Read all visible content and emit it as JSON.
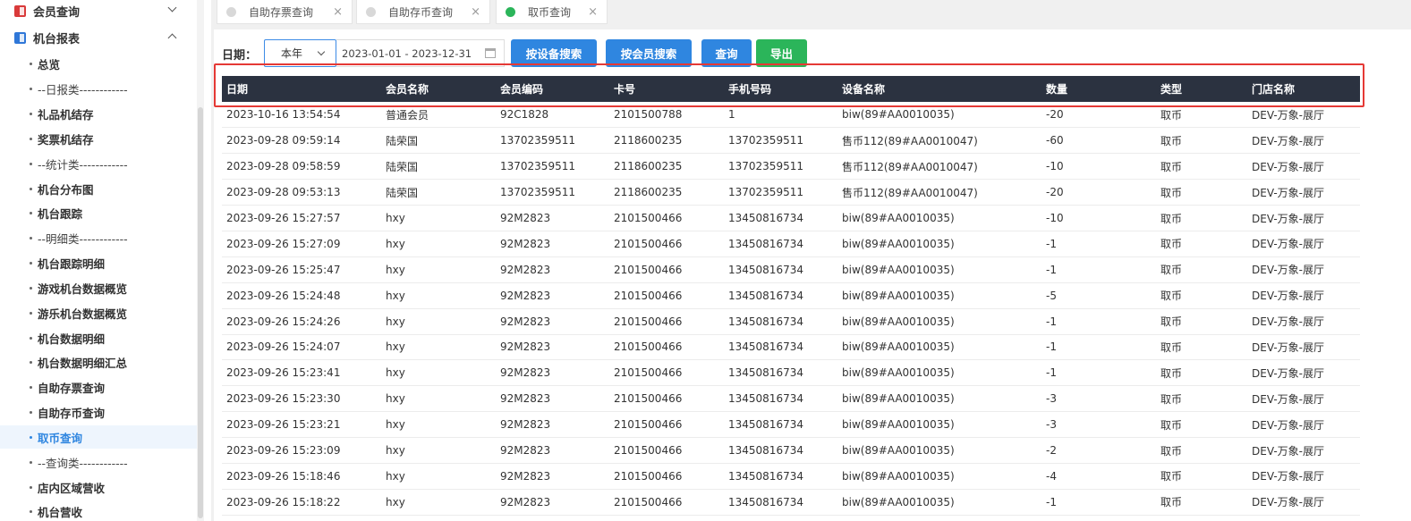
{
  "sidebar": {
    "groups": [
      {
        "label": "会员查询",
        "icon": "member-report-icon",
        "color": "#d93a3a"
      },
      {
        "label": "机台报表",
        "icon": "machine-report-icon",
        "color": "#2f77d8"
      }
    ],
    "items": [
      {
        "label": "总览"
      },
      {
        "label": "--日报类------------"
      },
      {
        "label": "礼品机结存"
      },
      {
        "label": "奖票机结存"
      },
      {
        "label": "--统计类------------"
      },
      {
        "label": "机台分布图"
      },
      {
        "label": "机台跟踪"
      },
      {
        "label": "--明细类------------"
      },
      {
        "label": "机台跟踪明细"
      },
      {
        "label": "游戏机台数据概览"
      },
      {
        "label": "游乐机台数据概览"
      },
      {
        "label": "机台数据明细"
      },
      {
        "label": "机台数据明细汇总"
      },
      {
        "label": "自助存票查询"
      },
      {
        "label": "自助存币查询"
      },
      {
        "label": "取币查询"
      },
      {
        "label": "--查询类------------"
      },
      {
        "label": "店内区域营收"
      },
      {
        "label": "机台营收"
      }
    ]
  },
  "tabs": [
    {
      "label": "自助存票查询",
      "close": "×"
    },
    {
      "label": "自助存币查询",
      "close": "×"
    },
    {
      "label": "取币查询",
      "close": "×",
      "active_color": "#2bb55a"
    }
  ],
  "filter": {
    "date_label": "日期：",
    "period_value": "本年",
    "date_range": "2023-01-01 - 2023-12-31",
    "buttons": {
      "by_device": "按设备搜索",
      "by_member": "按会员搜索",
      "query": "查询",
      "export": "导出"
    }
  },
  "table": {
    "headers": [
      "日期",
      "会员名称",
      "会员编码",
      "卡号",
      "手机号码",
      "设备名称",
      "数量",
      "类型",
      "门店名称"
    ],
    "rows": [
      [
        "2023-10-16 13:54:54",
        "普通会员",
        "92C1828",
        "2101500788",
        "1",
        "biw(89#AA0010035)",
        "-20",
        "取币",
        "DEV-万象-展厅"
      ],
      [
        "2023-09-28 09:59:14",
        "陆荣国",
        "13702359511",
        "2118600235",
        "13702359511",
        "售币112(89#AA0010047)",
        "-60",
        "取币",
        "DEV-万象-展厅"
      ],
      [
        "2023-09-28 09:58:59",
        "陆荣国",
        "13702359511",
        "2118600235",
        "13702359511",
        "售币112(89#AA0010047)",
        "-10",
        "取币",
        "DEV-万象-展厅"
      ],
      [
        "2023-09-28 09:53:13",
        "陆荣国",
        "13702359511",
        "2118600235",
        "13702359511",
        "售币112(89#AA0010047)",
        "-20",
        "取币",
        "DEV-万象-展厅"
      ],
      [
        "2023-09-26 15:27:57",
        "hxy",
        "92M2823",
        "2101500466",
        "13450816734",
        "biw(89#AA0010035)",
        "-10",
        "取币",
        "DEV-万象-展厅"
      ],
      [
        "2023-09-26 15:27:09",
        "hxy",
        "92M2823",
        "2101500466",
        "13450816734",
        "biw(89#AA0010035)",
        "-1",
        "取币",
        "DEV-万象-展厅"
      ],
      [
        "2023-09-26 15:25:47",
        "hxy",
        "92M2823",
        "2101500466",
        "13450816734",
        "biw(89#AA0010035)",
        "-1",
        "取币",
        "DEV-万象-展厅"
      ],
      [
        "2023-09-26 15:24:48",
        "hxy",
        "92M2823",
        "2101500466",
        "13450816734",
        "biw(89#AA0010035)",
        "-5",
        "取币",
        "DEV-万象-展厅"
      ],
      [
        "2023-09-26 15:24:26",
        "hxy",
        "92M2823",
        "2101500466",
        "13450816734",
        "biw(89#AA0010035)",
        "-1",
        "取币",
        "DEV-万象-展厅"
      ],
      [
        "2023-09-26 15:24:07",
        "hxy",
        "92M2823",
        "2101500466",
        "13450816734",
        "biw(89#AA0010035)",
        "-1",
        "取币",
        "DEV-万象-展厅"
      ],
      [
        "2023-09-26 15:23:41",
        "hxy",
        "92M2823",
        "2101500466",
        "13450816734",
        "biw(89#AA0010035)",
        "-1",
        "取币",
        "DEV-万象-展厅"
      ],
      [
        "2023-09-26 15:23:30",
        "hxy",
        "92M2823",
        "2101500466",
        "13450816734",
        "biw(89#AA0010035)",
        "-3",
        "取币",
        "DEV-万象-展厅"
      ],
      [
        "2023-09-26 15:23:21",
        "hxy",
        "92M2823",
        "2101500466",
        "13450816734",
        "biw(89#AA0010035)",
        "-3",
        "取币",
        "DEV-万象-展厅"
      ],
      [
        "2023-09-26 15:23:09",
        "hxy",
        "92M2823",
        "2101500466",
        "13450816734",
        "biw(89#AA0010035)",
        "-2",
        "取币",
        "DEV-万象-展厅"
      ],
      [
        "2023-09-26 15:18:46",
        "hxy",
        "92M2823",
        "2101500466",
        "13450816734",
        "biw(89#AA0010035)",
        "-4",
        "取币",
        "DEV-万象-展厅"
      ],
      [
        "2023-09-26 15:18:22",
        "hxy",
        "92M2823",
        "2101500466",
        "13450816734",
        "biw(89#AA0010035)",
        "-1",
        "取币",
        "DEV-万象-展厅"
      ]
    ]
  },
  "colors": {
    "accent": "#2f86e0",
    "success": "#2bb55a",
    "header_bg": "#2b3240",
    "highlight_border": "#e53935"
  }
}
